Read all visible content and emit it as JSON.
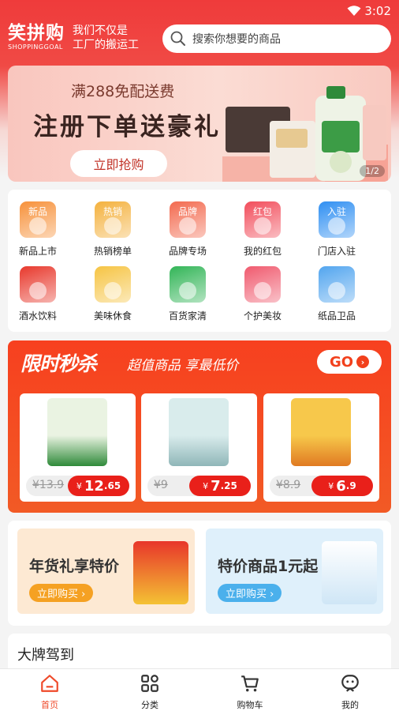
{
  "status": {
    "time": "3:02"
  },
  "header": {
    "logo": "笑拼购",
    "logo_sub": "SHOPPINGGOAL",
    "slogan_line1": "我们不仅是",
    "slogan_line2": "工厂的搬运工",
    "search_placeholder": "搜索你想要的商品"
  },
  "banner": {
    "tag": "满288免配送费",
    "headline": "注册下单送豪礼",
    "cta": "立即抢购",
    "pager": "1/2"
  },
  "categories": [
    {
      "label": "新品上市",
      "icon": "new-icon",
      "badge": "新品",
      "color": "#f7913a"
    },
    {
      "label": "热销榜单",
      "icon": "trophy-icon",
      "badge": "热销",
      "color": "#f4b13d"
    },
    {
      "label": "品牌专场",
      "icon": "brand-icon",
      "badge": "品牌",
      "color": "#f36a4f"
    },
    {
      "label": "我的红包",
      "icon": "red-packet-icon",
      "badge": "红包",
      "color": "#f24d5b"
    },
    {
      "label": "门店入驻",
      "icon": "store-icon",
      "badge": "入驻",
      "color": "#2f8ff2"
    },
    {
      "label": "酒水饮料",
      "icon": "drink-icon",
      "badge": "",
      "color": "#e8382c"
    },
    {
      "label": "美味休食",
      "icon": "snack-icon",
      "badge": "",
      "color": "#f6c443"
    },
    {
      "label": "百货家清",
      "icon": "detergent-icon",
      "badge": "",
      "color": "#32b557"
    },
    {
      "label": "个护美妆",
      "icon": "cosmetics-icon",
      "badge": "",
      "color": "#f05a6e"
    },
    {
      "label": "纸品卫品",
      "icon": "tissue-icon",
      "badge": "",
      "color": "#52a5ef"
    }
  ],
  "flash": {
    "title": "限时秒杀",
    "subtitle": "超值商品 享最低价",
    "go": "GO",
    "products": [
      {
        "orig": "¥13.9",
        "currency": "¥",
        "price_int": "12",
        "price_dec": ".65",
        "img": "detergent-bottle-icon"
      },
      {
        "orig": "¥9",
        "currency": "¥",
        "price_int": "7",
        "price_dec": ".25",
        "img": "cleaning-pad-icon"
      },
      {
        "orig": "¥8.9",
        "currency": "¥",
        "price_int": "6",
        "price_dec": ".9",
        "img": "dried-mango-icon"
      }
    ]
  },
  "promos": [
    {
      "title": "年货礼享特价",
      "button": "立即购买 ›",
      "bg": "#fde9d3",
      "btn_color": "#f5a123",
      "img": "snack-bag-icon"
    },
    {
      "title": "特价商品1元起",
      "button": "立即购买 ›",
      "bg": "#dff0fb",
      "btn_color": "#4bb0ec",
      "img": "tissue-pack-icon"
    }
  ],
  "brand_section": {
    "title": "大牌驾到"
  },
  "tabs": [
    {
      "label": "首页",
      "icon": "home-icon",
      "active": true
    },
    {
      "label": "分类",
      "icon": "category-icon",
      "active": false
    },
    {
      "label": "购物车",
      "icon": "cart-icon",
      "active": false
    },
    {
      "label": "我的",
      "icon": "profile-icon",
      "active": false
    }
  ]
}
